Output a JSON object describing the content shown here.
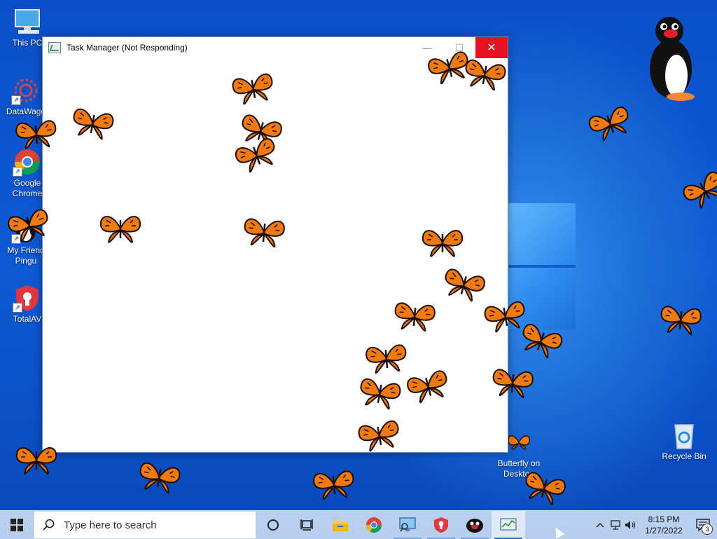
{
  "desktop": {
    "icons": [
      {
        "label": "This PC",
        "icon": "computer-icon"
      },
      {
        "label": "DataWago",
        "icon": "datawago-icon"
      },
      {
        "label": "Google Chrome",
        "icon": "chrome-icon"
      },
      {
        "label": "My Friend Pingu",
        "icon": "pingu-icon"
      },
      {
        "label": "TotalAV",
        "icon": "shield-icon"
      },
      {
        "label": "Butterfly on Desktop",
        "icon": "butterfly-icon"
      },
      {
        "label": "Recycle Bin",
        "icon": "recycle-bin-icon"
      }
    ]
  },
  "window": {
    "title": "Task Manager (Not Responding)",
    "minimize_label": "—",
    "maximize_label": "☐",
    "close_label": "✕"
  },
  "taskbar": {
    "search_placeholder": "Type here to search",
    "pinned": [
      {
        "name": "cortana",
        "icon": "cortana-circle-icon"
      },
      {
        "name": "task-view",
        "icon": "task-view-icon"
      },
      {
        "name": "file-explorer",
        "icon": "folder-icon"
      },
      {
        "name": "chrome",
        "icon": "chrome-icon"
      },
      {
        "name": "magnifier-app",
        "icon": "monitor-search-icon"
      },
      {
        "name": "totalav",
        "icon": "shield-icon"
      },
      {
        "name": "pingu",
        "icon": "pingu-icon"
      },
      {
        "name": "task-manager",
        "icon": "task-manager-icon"
      }
    ],
    "clock_time": "8:15 PM",
    "clock_date": "1/27/2022",
    "notification_count": "3"
  },
  "colors": {
    "close_red": "#e81123",
    "butterfly_orange": "#f07a12",
    "taskbar": "#d2e1f5"
  }
}
